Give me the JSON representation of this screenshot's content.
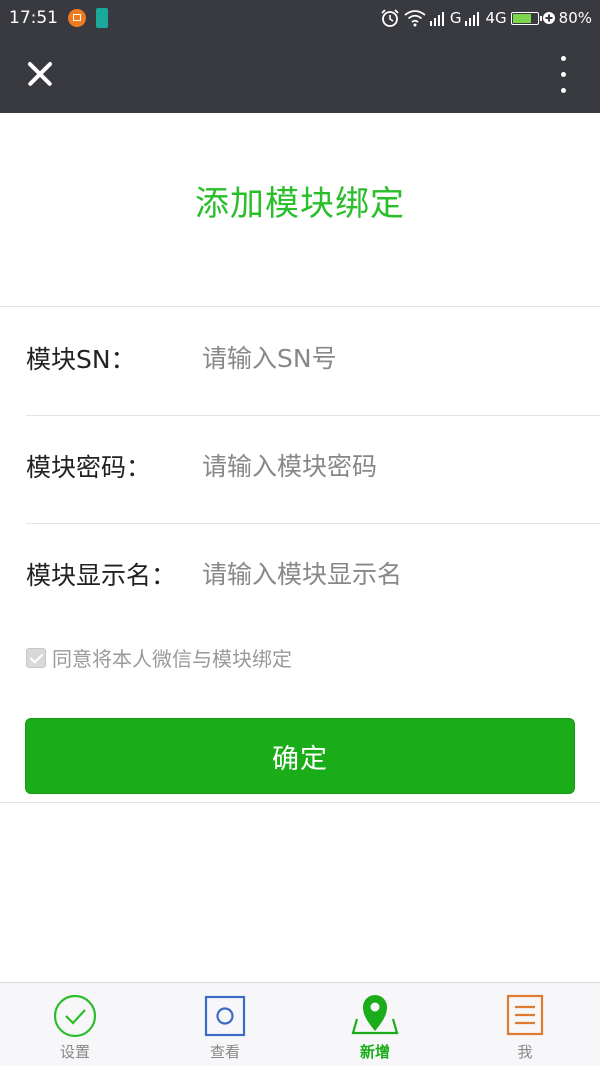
{
  "status_bar": {
    "time": "17:51",
    "network_1": "G",
    "network_2": "4G",
    "battery_percent": "80%",
    "battery_level": 0.8
  },
  "header": {
    "close_icon": "close-icon",
    "more_icon": "more-vertical-icon"
  },
  "page": {
    "title": "添加模块绑定"
  },
  "form": {
    "sn_label": "模块SN：",
    "sn_placeholder": "请输入SN号",
    "password_label": "模块密码：",
    "password_placeholder": "请输入模块密码",
    "display_name_label": "模块显示名：",
    "display_name_placeholder": "请输入模块显示名",
    "agree_text": "同意将本人微信与模块绑定",
    "agree_checked": true,
    "confirm_label": "确定"
  },
  "tabs": [
    {
      "label": "设置",
      "icon": "check-circle-icon",
      "active": false
    },
    {
      "label": "查看",
      "icon": "view-square-icon",
      "active": false
    },
    {
      "label": "新增",
      "icon": "map-pin-icon",
      "active": true
    },
    {
      "label": "我",
      "icon": "document-icon",
      "active": false
    }
  ],
  "colors": {
    "accent": "#1aad19",
    "title_green": "#2bbe2b",
    "header_bg": "#393a3f",
    "tab_blue": "#3a6cc4",
    "tab_orange": "#e07a2e"
  }
}
